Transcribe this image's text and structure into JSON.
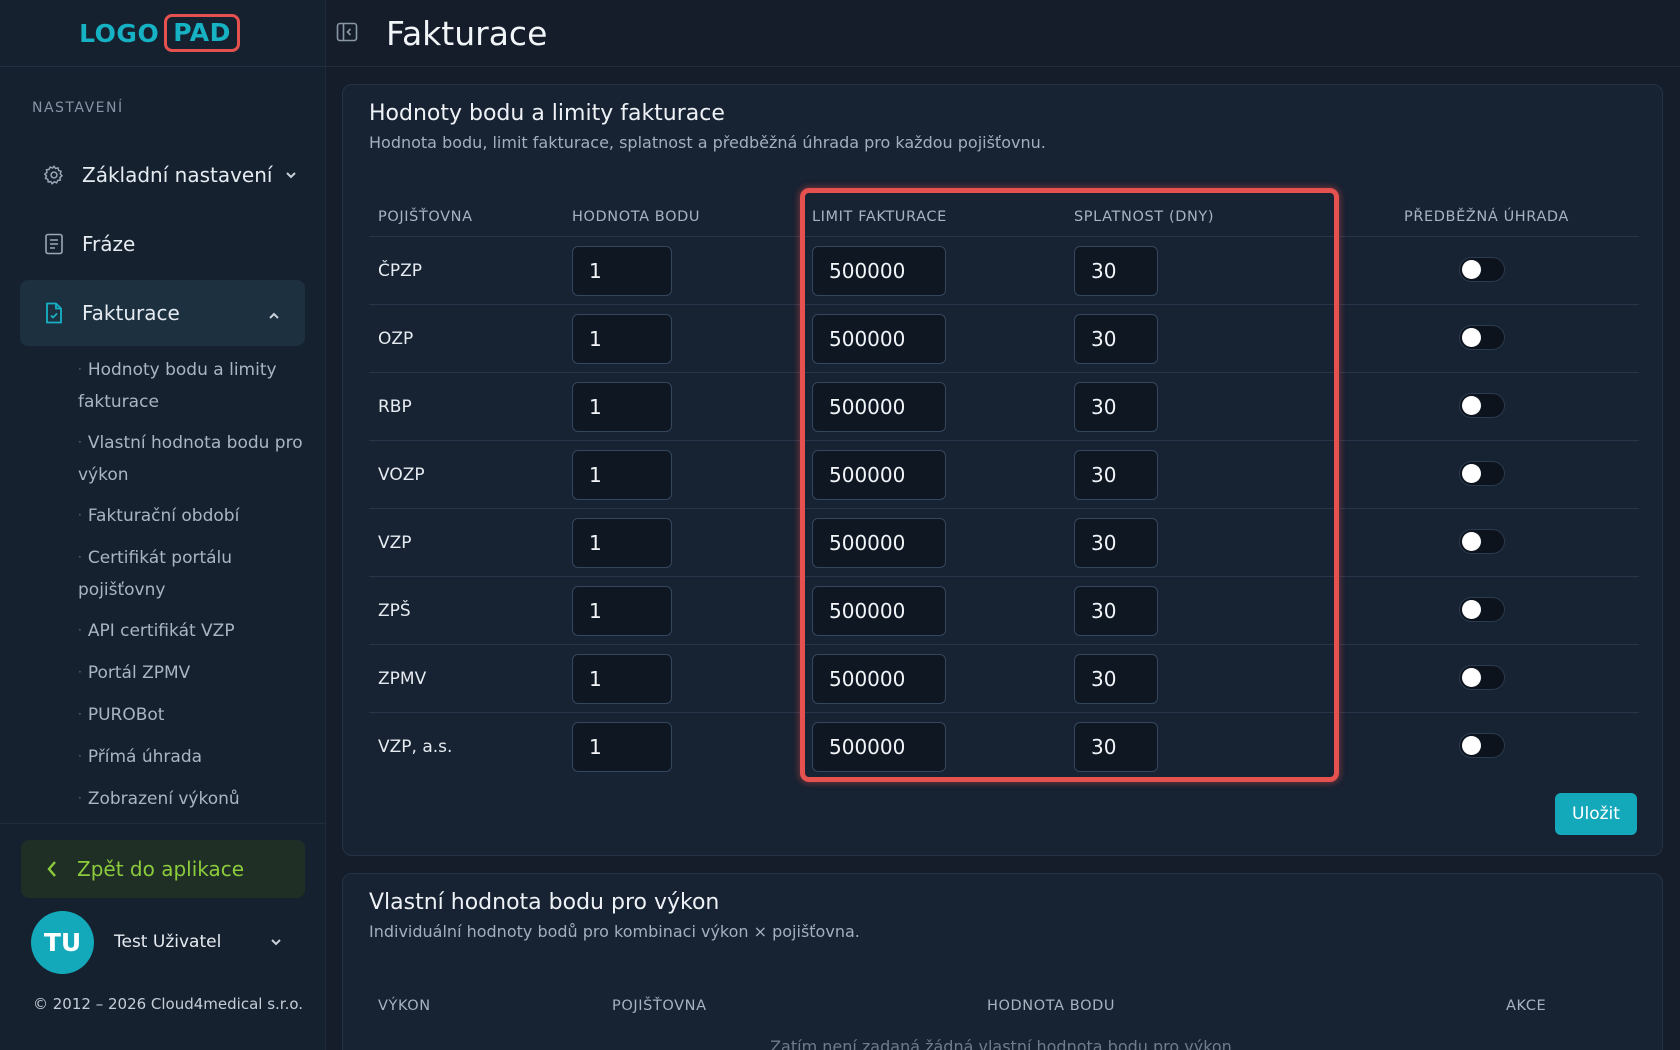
{
  "logo": {
    "left": "LOGO",
    "right": "PAD"
  },
  "sidebar": {
    "section_label": "NASTAVENÍ",
    "items": [
      {
        "label": "Základní nastavení",
        "icon": "gear-icon",
        "expanded": false
      },
      {
        "label": "Fráze",
        "icon": "document-icon"
      },
      {
        "label": "Fakturace",
        "icon": "invoice-icon",
        "expanded": true,
        "active": true
      }
    ],
    "subitems": [
      "Hodnoty bodu a limity fakturace",
      "Vlastní hodnota bodu pro výkon",
      "Fakturační období",
      "Certifikát portálu pojišťovny",
      "API certifikát VZP",
      "Portál ZPMV",
      "PUROBot",
      "Přímá úhrada",
      "Zobrazení výkonů"
    ],
    "back_label": "Zpět do aplikace",
    "user": {
      "initials": "TU",
      "name": "Test Uživatel"
    },
    "copyright": "© 2012 – 2026 Cloud4medical s.r.o."
  },
  "header": {
    "title": "Fakturace"
  },
  "section1": {
    "title": "Hodnoty bodu a limity fakturace",
    "subtitle": "Hodnota bodu, limit fakturace, splatnost a předběžná úhrada pro každou pojišťovnu.",
    "columns": [
      "POJIŠŤOVNA",
      "HODNOTA BODU",
      "LIMIT FAKTURACE",
      "SPLATNOST (DNY)",
      "PŘEDBĚŽNÁ ÚHRADA"
    ],
    "rows": [
      {
        "name": "ČPZP",
        "hodnota": "1",
        "limit": "500000",
        "splatnost": "30",
        "uhrada": false
      },
      {
        "name": "OZP",
        "hodnota": "1",
        "limit": "500000",
        "splatnost": "30",
        "uhrada": false
      },
      {
        "name": "RBP",
        "hodnota": "1",
        "limit": "500000",
        "splatnost": "30",
        "uhrada": false
      },
      {
        "name": "VOZP",
        "hodnota": "1",
        "limit": "500000",
        "splatnost": "30",
        "uhrada": false
      },
      {
        "name": "VZP",
        "hodnota": "1",
        "limit": "500000",
        "splatnost": "30",
        "uhrada": false
      },
      {
        "name": "ZPŠ",
        "hodnota": "1",
        "limit": "500000",
        "splatnost": "30",
        "uhrada": false
      },
      {
        "name": "ZPMV",
        "hodnota": "1",
        "limit": "500000",
        "splatnost": "30",
        "uhrada": false
      },
      {
        "name": "VZP, a.s.",
        "hodnota": "1",
        "limit": "500000",
        "splatnost": "30",
        "uhrada": false
      }
    ],
    "save_label": "Uložit"
  },
  "section2": {
    "title": "Vlastní hodnota bodu pro výkon",
    "subtitle": "Individuální hodnoty bodů pro kombinaci výkon × pojišťovna.",
    "columns": [
      "VÝKON",
      "POJIŠŤOVNA",
      "HODNOTA BODU",
      "AKCE"
    ],
    "empty_message": "Zatím není zadaná žádná vlastní hodnota bodu pro výkon."
  },
  "colors": {
    "accent": "#14a9ba",
    "highlight": "#e5514e",
    "back_button_text": "#8ccb3b",
    "background": "#141d29"
  }
}
